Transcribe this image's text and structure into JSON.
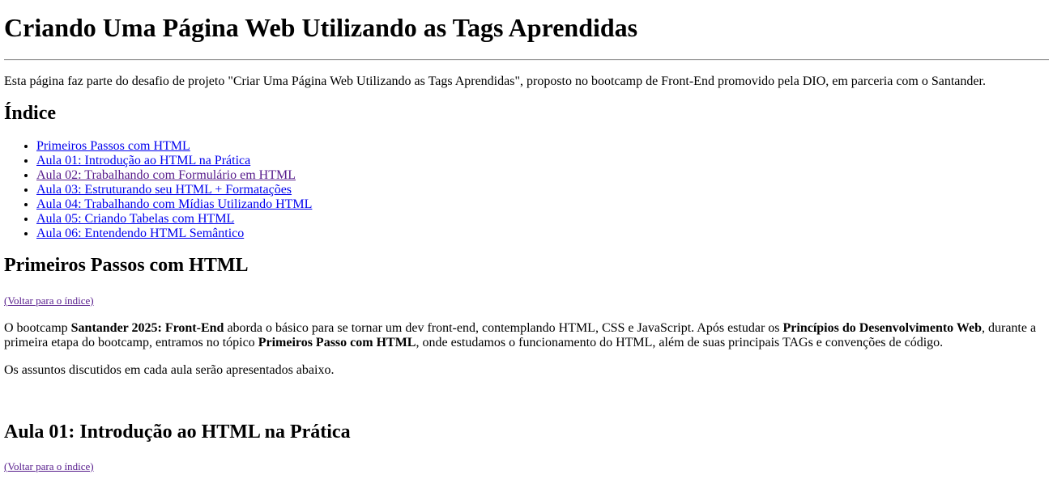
{
  "page": {
    "title": "Criando Uma Página Web Utilizando as Tags Aprendidas",
    "intro": "Esta página faz parte do desafio de projeto \"Criar Uma Página Web Utilizando as Tags Aprendidas\", proposto no bootcamp de Front-End promovido pela DIO, em parceria com o Santander."
  },
  "index": {
    "heading": "Índice",
    "items": [
      {
        "label": "Primeiros Passos com HTML"
      },
      {
        "label": "Aula 01: Introdução ao HTML na Prática"
      },
      {
        "label": "Aula 02: Trabalhando com Formulário em HTML"
      },
      {
        "label": "Aula 03: Estruturando seu HTML + Formatações"
      },
      {
        "label": "Aula 04: Trabalhando com Mídias Utilizando HTML"
      },
      {
        "label": "Aula 05: Criando Tabelas com HTML"
      },
      {
        "label": "Aula 06: Entendendo HTML Semântico"
      }
    ]
  },
  "section_primeiros": {
    "heading": "Primeiros Passos com HTML",
    "back_link": "(Voltar para o índice)",
    "p1_part1": "O bootcamp ",
    "p1_bold1": "Santander 2025: Front-End",
    "p1_part2": " aborda o básico para se tornar um dev front-end, contemplando HTML, CSS e JavaScript. Após estudar os ",
    "p1_bold2": "Princípios do Desenvolvimento Web",
    "p1_part3": ", durante a primeira etapa do bootcamp, entramos no tópico ",
    "p1_bold3": "Primeiros Passo com HTML",
    "p1_part4": ", onde estudamos o funcionamento do HTML, além de suas principais TAGs e convenções de código.",
    "p2": "Os assuntos discutidos em cada aula serão apresentados abaixo."
  },
  "section_aula01": {
    "heading": "Aula 01: Introdução ao HTML na Prática",
    "back_link": "(Voltar para o índice)"
  },
  "colors": {
    "link": "#0000ee",
    "visited_link": "#551a8b"
  }
}
